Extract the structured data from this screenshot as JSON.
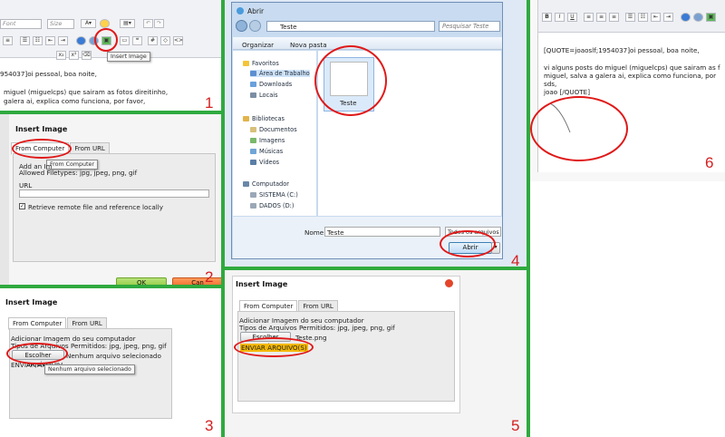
{
  "panel1": {
    "font_select": "Font",
    "size_select": "Size",
    "tooltip": "Insert Image",
    "text_line1": "954037]oi pessoal, boa noite,",
    "text_line2": "miguel (miguelcps) que sairam as fotos direitinho,",
    "text_line3": "galera ai, explica como funciona, por favor,",
    "number": "1"
  },
  "panel2": {
    "title": "Insert Image",
    "tab_computer": "From Computer",
    "tab_url": "From URL",
    "tooltip": "From Computer",
    "add_line": "Add an Im",
    "allowed": "Allowed Filetypes: jpg, jpeg, png, gif",
    "url_label": "URL",
    "retrieve": "Retrieve remote file and reference locally",
    "ok": "OK",
    "cancel": "Can",
    "number": "2"
  },
  "panel3": {
    "title": "Insert Image",
    "tab_computer": "From Computer",
    "tab_url": "From URL",
    "add_line": "Adicionar Imagem do seu computador",
    "types_line": "Tipos de Arquivos Permitidos: jpg, jpeg, png, gif",
    "choose_button": "Escolher arquivo",
    "no_file": "Nenhum arquivo selecionado",
    "tooltip": "Nenhum arquivo selecionado",
    "partial": "ENVIAR ARQUIV",
    "number": "3"
  },
  "panel4": {
    "window_title": "Abrir",
    "path": "Teste",
    "search_placeholder": "Pesquisar Teste",
    "organize": "Organizar",
    "new_folder": "Nova pasta",
    "favorites": "Favoritos",
    "fav_items": [
      "Área de Trabalho",
      "Downloads",
      "Locais"
    ],
    "libraries": "Bibliotecas",
    "lib_items": [
      "Documentos",
      "Imagens",
      "Músicas",
      "Vídeos"
    ],
    "computer": "Computador",
    "comp_items": [
      "SISTEMA (C:)",
      "DADOS (D:)"
    ],
    "file_label": "Teste",
    "filename_label": "Nome:",
    "filename_value": "Teste",
    "filetype": "Todos os arquivos",
    "open_button": "Abrir",
    "number": "4"
  },
  "panel5": {
    "title": "Insert Image",
    "tab_computer": "From Computer",
    "tab_url": "From URL",
    "add_line": "Adicionar Imagem do seu computador",
    "types_line": "Tipos de Arquivos Permitidos: jpg, jpeg, png, gif",
    "choose_button": "Escolher arquivo",
    "chosen_file": "Teste.png",
    "send_link": "ENVIAR ARQUIVO(S)",
    "number": "5"
  },
  "panel6": {
    "line1": "[QUOTE=joaoslf;1954037]oi pessoal, boa noite,",
    "line2": "vi alguns posts do miguel (miguelcps) que sairam as f",
    "line3": "miguel, salva a galera ai, explica como funciona, por",
    "line4": "sds,",
    "line5": "joao [/QUOTE]",
    "number": "6"
  },
  "colors": {
    "accent_green": "#2faa3f",
    "annotation_red": "#e01818",
    "send_orange": "#f5b800"
  }
}
